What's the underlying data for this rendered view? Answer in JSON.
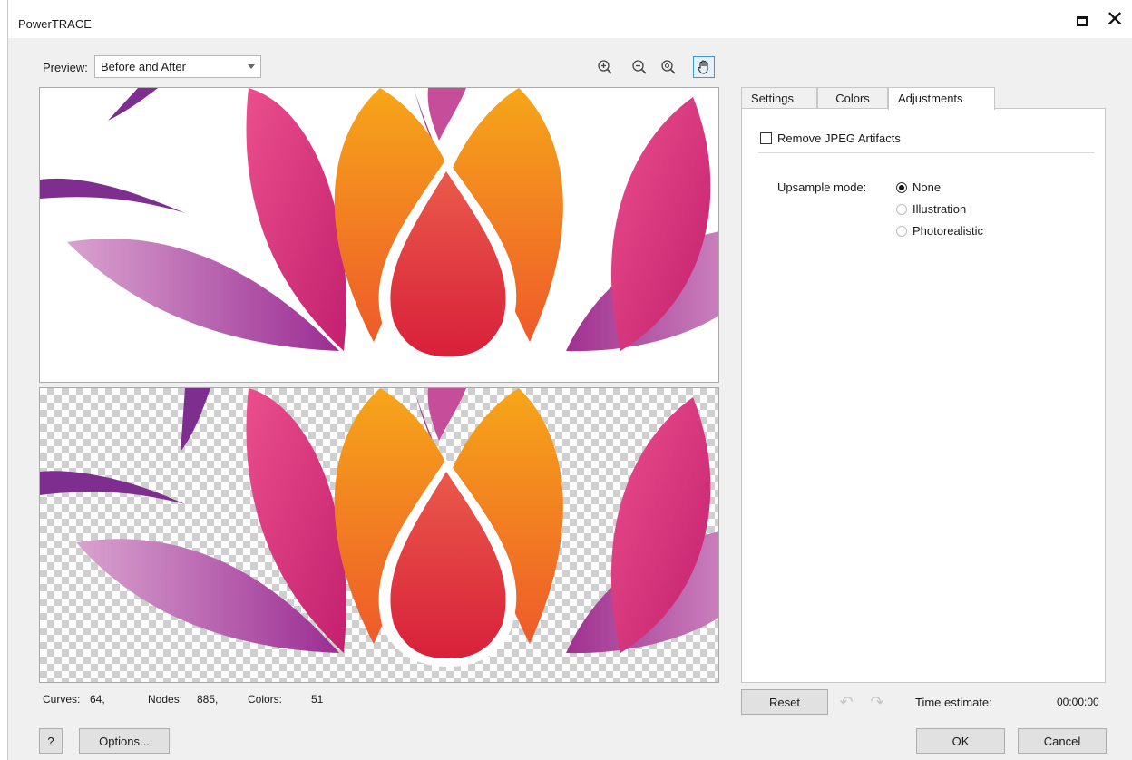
{
  "window": {
    "title": "PowerTRACE"
  },
  "preview": {
    "label": "Preview:",
    "selected": "Before and After"
  },
  "toolbar": {
    "zoom_in_icon": "zoom-in-icon",
    "zoom_out_icon": "zoom-out-icon",
    "zoom_fit_icon": "zoom-fit-icon",
    "pan_icon": "hand-icon"
  },
  "stats": {
    "curves_label": "Curves:",
    "curves_value": "64,",
    "nodes_label": "Nodes:",
    "nodes_value": "885,",
    "colors_label": "Colors:",
    "colors_value": "51"
  },
  "buttons": {
    "help": "?",
    "options": "Options...",
    "reset": "Reset",
    "ok": "OK",
    "cancel": "Cancel"
  },
  "tabs": [
    {
      "label": "Settings",
      "selected": false
    },
    {
      "label": "Colors",
      "selected": false
    },
    {
      "label": "Adjustments",
      "selected": true
    }
  ],
  "adjustments": {
    "remove_jpeg_label": "Remove JPEG Artifacts",
    "remove_jpeg_checked": false,
    "upsample_label": "Upsample mode:",
    "upsample_options": [
      "None",
      "Illustration",
      "Photorealistic"
    ],
    "upsample_selected": "None"
  },
  "time_estimate": {
    "label": "Time estimate:",
    "value": "00:00:00"
  },
  "colors": {
    "petal_pink": "#e0307a",
    "petal_orange": "#f28a1e",
    "center_red": "#e0383a",
    "leaf_purple": "#a5359a",
    "accent_blue": "#3c95e0"
  }
}
